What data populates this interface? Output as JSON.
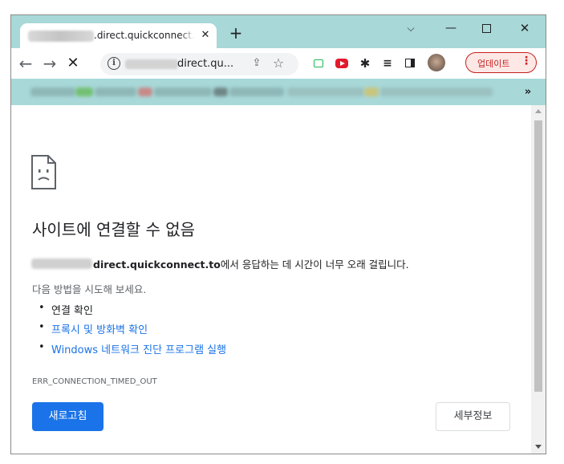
{
  "tab": {
    "title": ".direct.quickconnect.to",
    "close_icon": "close-icon",
    "new_tab_label": "+"
  },
  "window_controls": {
    "tab_search": "⌵",
    "minimize": "—",
    "close": "✕"
  },
  "toolbar": {
    "back": "←",
    "forward": "→",
    "stop": "✕",
    "url": "direct.qu...",
    "update_label": "업데이트",
    "menu_label": "⋮",
    "bookmarks_more": "»"
  },
  "error_page": {
    "headline": "사이트에 연결할 수 없음",
    "host_bold": "direct.quickconnect.to",
    "description_suffix": "에서 응답하는 데 시간이 너무 오래 걸립니다.",
    "try_label": "다음 방법을 시도해 보세요.",
    "suggestions": [
      "연결 확인",
      "프록시 및 방화벽 확인",
      "Windows 네트워크 진단 프로그램 실행"
    ],
    "error_code": "ERR_CONNECTION_TIMED_OUT",
    "reload_label": "새로고침",
    "details_label": "세부정보"
  },
  "colors": {
    "frame": "#a8d8d8",
    "link": "#1a73e8",
    "primary_button": "#1a73e8",
    "update_accent": "#c5221f"
  }
}
